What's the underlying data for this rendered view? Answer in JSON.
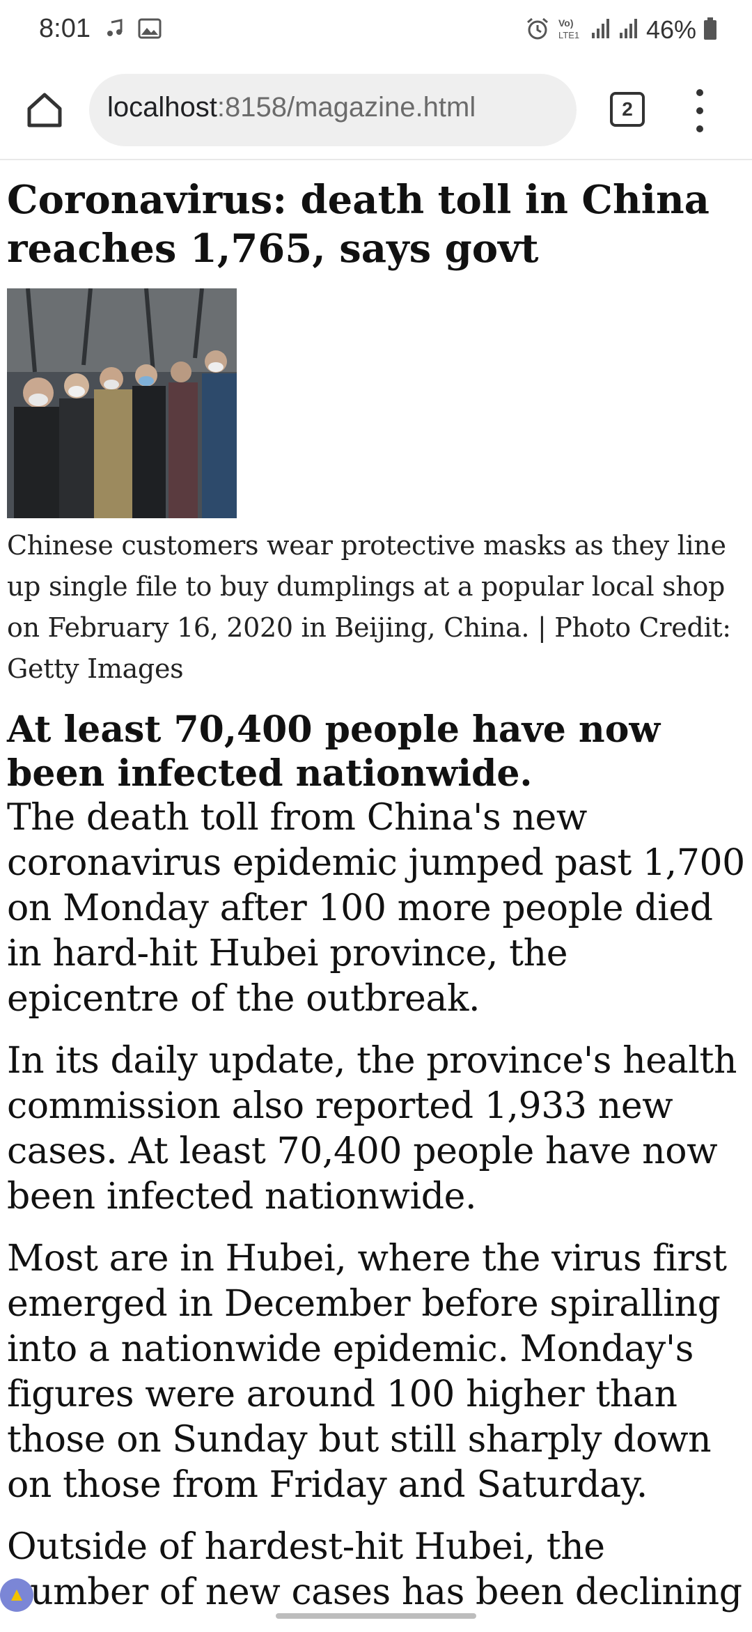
{
  "status_bar": {
    "time": "8:01",
    "battery_percent": "46%",
    "network_label": "Vo) LTE1",
    "icons": [
      "music-note-icon",
      "image-icon",
      "alarm-icon",
      "lte-icon",
      "signal-icon",
      "signal-icon",
      "battery-icon"
    ]
  },
  "browser": {
    "url_host": "localhost",
    "url_rest": ":8158/magazine.html",
    "tab_count": "2",
    "icons": [
      "home-icon",
      "tabs-icon",
      "more-vert-icon"
    ]
  },
  "article": {
    "headline": "Coronavirus: death toll in China reaches 1,765, says govt",
    "photo_caption": "Chinese customers wear protective masks as they line up single file to buy dumplings at a popular local shop on February 16, 2020 in Beijing, China. | Photo Credit: Getty Images",
    "subhead": "At least 70,400 people have now been infected nationwide.",
    "paragraphs": [
      "The death toll from China's new coronavirus epidemic jumped past 1,700 on Monday after 100 more people died in hard-hit Hubei province, the epicentre of the outbreak.",
      "In its daily update, the province's health commission also reported 1,933 new cases. At least 70,400 people have now been infected nationwide.",
      "Most are in Hubei, where the virus first emerged in December before spiralling into a nationwide epidemic. Monday's figures were around 100 higher than those on Sunday but still sharply down on those from Friday and Saturday.",
      "Outside of hardest-hit Hubei, the number of new cases has been declining"
    ]
  },
  "colors": {
    "text": "#111111",
    "url_bar_bg": "#efefef",
    "badge": "#7b86d6"
  }
}
